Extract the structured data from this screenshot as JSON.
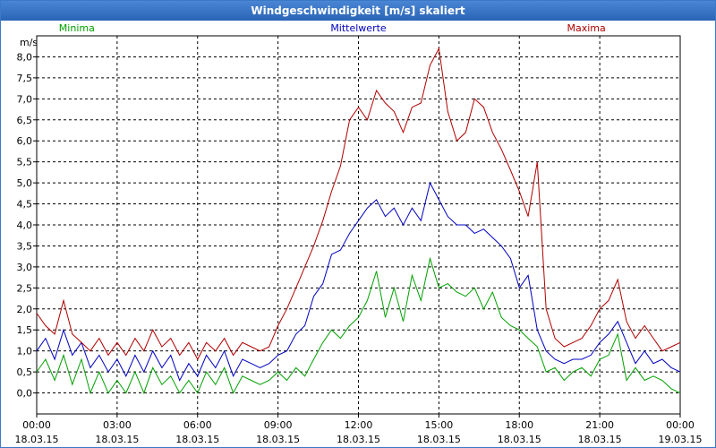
{
  "window": {
    "title": "Windgeschwindigkeit [m/s] skaliert"
  },
  "chart_data": {
    "type": "line",
    "title": "Windgeschwindigkeit [m/s] skaliert",
    "ylabel": "m/s",
    "xlabel": "",
    "ylim": [
      -0.5,
      8.5
    ],
    "xlim": [
      0,
      24
    ],
    "grid": true,
    "legend_placement": "top",
    "y_ticks": [
      "0,0",
      "0,5",
      "1,0",
      "1,5",
      "2,0",
      "2,5",
      "3,0",
      "3,5",
      "4,0",
      "4,5",
      "5,0",
      "5,5",
      "6,0",
      "6,5",
      "7,0",
      "7,5",
      "8,0"
    ],
    "y_tick_values": [
      0,
      0.5,
      1,
      1.5,
      2,
      2.5,
      3,
      3.5,
      4,
      4.5,
      5,
      5.5,
      6,
      6.5,
      7,
      7.5,
      8
    ],
    "x_ticks": [
      {
        "time": "00:00",
        "date": "18.03.15"
      },
      {
        "time": "03:00",
        "date": "18.03.15"
      },
      {
        "time": "06:00",
        "date": "18.03.15"
      },
      {
        "time": "09:00",
        "date": "18.03.15"
      },
      {
        "time": "12:00",
        "date": "18.03.15"
      },
      {
        "time": "15:00",
        "date": "18.03.15"
      },
      {
        "time": "18:00",
        "date": "18.03.15"
      },
      {
        "time": "21:00",
        "date": "18.03.15"
      },
      {
        "time": "00:00",
        "date": "19.03.15"
      }
    ],
    "series": [
      {
        "name": "Minima",
        "color": "#00a000",
        "points": [
          [
            0,
            0.5
          ],
          [
            0.33,
            0.8
          ],
          [
            0.67,
            0.3
          ],
          [
            1,
            0.9
          ],
          [
            1.33,
            0.2
          ],
          [
            1.67,
            0.8
          ],
          [
            2,
            0
          ],
          [
            2.33,
            0.5
          ],
          [
            2.67,
            0
          ],
          [
            3,
            0.3
          ],
          [
            3.33,
            0
          ],
          [
            3.67,
            0.5
          ],
          [
            4,
            0
          ],
          [
            4.33,
            0.6
          ],
          [
            4.67,
            0.2
          ],
          [
            5,
            0.4
          ],
          [
            5.33,
            0
          ],
          [
            5.67,
            0.3
          ],
          [
            6,
            0
          ],
          [
            6.33,
            0.5
          ],
          [
            6.67,
            0.2
          ],
          [
            7,
            0.6
          ],
          [
            7.33,
            0
          ],
          [
            7.67,
            0.4
          ],
          [
            8,
            0.3
          ],
          [
            8.33,
            0.2
          ],
          [
            8.67,
            0.3
          ],
          [
            9,
            0.5
          ],
          [
            9.33,
            0.3
          ],
          [
            9.67,
            0.6
          ],
          [
            10,
            0.4
          ],
          [
            10.33,
            0.8
          ],
          [
            10.67,
            1.2
          ],
          [
            11,
            1.5
          ],
          [
            11.33,
            1.3
          ],
          [
            11.67,
            1.6
          ],
          [
            12,
            1.8
          ],
          [
            12.33,
            2.2
          ],
          [
            12.67,
            2.9
          ],
          [
            13,
            1.8
          ],
          [
            13.33,
            2.5
          ],
          [
            13.67,
            1.7
          ],
          [
            14,
            2.8
          ],
          [
            14.33,
            2.2
          ],
          [
            14.67,
            3.2
          ],
          [
            15,
            2.5
          ],
          [
            15.33,
            2.6
          ],
          [
            15.67,
            2.4
          ],
          [
            16,
            2.3
          ],
          [
            16.33,
            2.5
          ],
          [
            16.67,
            2.0
          ],
          [
            17,
            2.4
          ],
          [
            17.33,
            1.8
          ],
          [
            17.67,
            1.6
          ],
          [
            18,
            1.5
          ],
          [
            18.33,
            1.3
          ],
          [
            18.67,
            1.1
          ],
          [
            19,
            0.5
          ],
          [
            19.33,
            0.6
          ],
          [
            19.67,
            0.3
          ],
          [
            20,
            0.5
          ],
          [
            20.33,
            0.6
          ],
          [
            20.67,
            0.4
          ],
          [
            21,
            0.8
          ],
          [
            21.33,
            0.9
          ],
          [
            21.67,
            1.4
          ],
          [
            22,
            0.3
          ],
          [
            22.33,
            0.6
          ],
          [
            22.67,
            0.3
          ],
          [
            23,
            0.4
          ],
          [
            23.33,
            0.3
          ],
          [
            23.67,
            0.1
          ],
          [
            24,
            0
          ]
        ]
      },
      {
        "name": "Mittelwerte",
        "color": "#0000c0",
        "points": [
          [
            0,
            1.0
          ],
          [
            0.33,
            1.3
          ],
          [
            0.67,
            0.8
          ],
          [
            1,
            1.5
          ],
          [
            1.33,
            0.9
          ],
          [
            1.67,
            1.2
          ],
          [
            2,
            0.6
          ],
          [
            2.33,
            0.9
          ],
          [
            2.67,
            0.5
          ],
          [
            3,
            0.8
          ],
          [
            3.33,
            0.4
          ],
          [
            3.67,
            0.9
          ],
          [
            4,
            0.5
          ],
          [
            4.33,
            1.0
          ],
          [
            4.67,
            0.6
          ],
          [
            5,
            0.9
          ],
          [
            5.33,
            0.3
          ],
          [
            5.67,
            0.7
          ],
          [
            6,
            0.4
          ],
          [
            6.33,
            0.9
          ],
          [
            6.67,
            0.6
          ],
          [
            7,
            1.0
          ],
          [
            7.33,
            0.4
          ],
          [
            7.67,
            0.8
          ],
          [
            8,
            0.7
          ],
          [
            8.33,
            0.6
          ],
          [
            8.67,
            0.7
          ],
          [
            9,
            0.9
          ],
          [
            9.33,
            1.0
          ],
          [
            9.67,
            1.4
          ],
          [
            10,
            1.6
          ],
          [
            10.33,
            2.3
          ],
          [
            10.67,
            2.6
          ],
          [
            11,
            3.3
          ],
          [
            11.33,
            3.4
          ],
          [
            11.67,
            3.8
          ],
          [
            12,
            4.1
          ],
          [
            12.33,
            4.4
          ],
          [
            12.67,
            4.6
          ],
          [
            13,
            4.2
          ],
          [
            13.33,
            4.4
          ],
          [
            13.67,
            4.0
          ],
          [
            14,
            4.4
          ],
          [
            14.33,
            4.1
          ],
          [
            14.67,
            5.0
          ],
          [
            15,
            4.6
          ],
          [
            15.33,
            4.2
          ],
          [
            15.67,
            4.0
          ],
          [
            16,
            4.0
          ],
          [
            16.33,
            3.8
          ],
          [
            16.67,
            3.9
          ],
          [
            17,
            3.7
          ],
          [
            17.33,
            3.5
          ],
          [
            17.67,
            3.2
          ],
          [
            18,
            2.5
          ],
          [
            18.33,
            2.8
          ],
          [
            18.67,
            1.5
          ],
          [
            19,
            1.0
          ],
          [
            19.33,
            0.8
          ],
          [
            19.67,
            0.7
          ],
          [
            20,
            0.8
          ],
          [
            20.33,
            0.8
          ],
          [
            20.67,
            0.9
          ],
          [
            21,
            1.2
          ],
          [
            21.33,
            1.4
          ],
          [
            21.67,
            1.7
          ],
          [
            22,
            1.2
          ],
          [
            22.33,
            0.7
          ],
          [
            22.67,
            1.0
          ],
          [
            23,
            0.7
          ],
          [
            23.33,
            0.8
          ],
          [
            23.67,
            0.6
          ],
          [
            24,
            0.5
          ]
        ]
      },
      {
        "name": "Maxima",
        "color": "#b00000",
        "points": [
          [
            0,
            1.9
          ],
          [
            0.33,
            1.6
          ],
          [
            0.67,
            1.4
          ],
          [
            1,
            2.2
          ],
          [
            1.33,
            1.4
          ],
          [
            1.67,
            1.2
          ],
          [
            2,
            1.0
          ],
          [
            2.33,
            1.3
          ],
          [
            2.67,
            0.9
          ],
          [
            3,
            1.2
          ],
          [
            3.33,
            0.9
          ],
          [
            3.67,
            1.3
          ],
          [
            4,
            1.0
          ],
          [
            4.33,
            1.5
          ],
          [
            4.67,
            1.1
          ],
          [
            5,
            1.3
          ],
          [
            5.33,
            0.9
          ],
          [
            5.67,
            1.2
          ],
          [
            6,
            0.8
          ],
          [
            6.33,
            1.2
          ],
          [
            6.67,
            1.0
          ],
          [
            7,
            1.3
          ],
          [
            7.33,
            0.9
          ],
          [
            7.67,
            1.2
          ],
          [
            8,
            1.1
          ],
          [
            8.33,
            1.0
          ],
          [
            8.67,
            1.1
          ],
          [
            9,
            1.6
          ],
          [
            9.33,
            2.0
          ],
          [
            9.67,
            2.5
          ],
          [
            10,
            3.0
          ],
          [
            10.33,
            3.5
          ],
          [
            10.67,
            4.1
          ],
          [
            11,
            4.8
          ],
          [
            11.33,
            5.4
          ],
          [
            11.67,
            6.5
          ],
          [
            12,
            6.8
          ],
          [
            12.33,
            6.5
          ],
          [
            12.67,
            7.2
          ],
          [
            13,
            6.9
          ],
          [
            13.33,
            6.7
          ],
          [
            13.67,
            6.2
          ],
          [
            14,
            6.8
          ],
          [
            14.33,
            6.9
          ],
          [
            14.67,
            7.8
          ],
          [
            15,
            8.2
          ],
          [
            15.33,
            6.7
          ],
          [
            15.67,
            6.0
          ],
          [
            16,
            6.2
          ],
          [
            16.33,
            7.0
          ],
          [
            16.67,
            6.8
          ],
          [
            17,
            6.2
          ],
          [
            17.33,
            5.8
          ],
          [
            17.67,
            5.3
          ],
          [
            18,
            4.8
          ],
          [
            18.33,
            4.2
          ],
          [
            18.67,
            5.5
          ],
          [
            19,
            2.0
          ],
          [
            19.33,
            1.3
          ],
          [
            19.67,
            1.1
          ],
          [
            20,
            1.2
          ],
          [
            20.33,
            1.3
          ],
          [
            20.67,
            1.6
          ],
          [
            21,
            2.0
          ],
          [
            21.33,
            2.2
          ],
          [
            21.67,
            2.7
          ],
          [
            22,
            1.7
          ],
          [
            22.33,
            1.3
          ],
          [
            22.67,
            1.6
          ],
          [
            23,
            1.3
          ],
          [
            23.33,
            1.0
          ],
          [
            23.67,
            1.1
          ],
          [
            24,
            1.2
          ]
        ]
      }
    ]
  }
}
